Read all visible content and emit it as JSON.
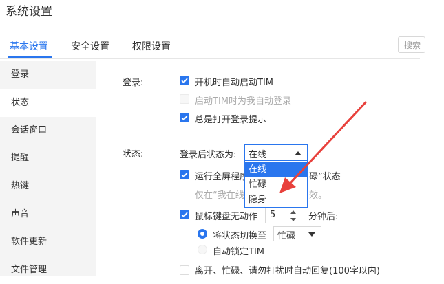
{
  "window": {
    "title": "系统设置"
  },
  "tabs": [
    {
      "label": "基本设置",
      "active": true
    },
    {
      "label": "安全设置",
      "active": false
    },
    {
      "label": "权限设置",
      "active": false
    }
  ],
  "search": {
    "placeholder": "搜索"
  },
  "sidebar": {
    "items": [
      {
        "label": "登录",
        "active": false
      },
      {
        "label": "状态",
        "active": true
      },
      {
        "label": "会话窗口",
        "active": false
      },
      {
        "label": "提醒",
        "active": false
      },
      {
        "label": "热键",
        "active": false
      },
      {
        "label": "声音",
        "active": false
      },
      {
        "label": "软件更新",
        "active": false
      },
      {
        "label": "文件管理",
        "active": false
      }
    ]
  },
  "login_section": {
    "label": "登录:",
    "options": [
      {
        "label": "开机时自动启动TIM",
        "checked": true,
        "disabled": false
      },
      {
        "label": "启动TIM时为我自动登录",
        "checked": false,
        "disabled": true
      },
      {
        "label": "总是打开登录提示",
        "checked": true,
        "disabled": false
      }
    ]
  },
  "status_section": {
    "label": "状态:",
    "after_login_label": "登录后状态为:",
    "after_login_value": "在线",
    "dropdown_options": [
      "在线",
      "忙碌",
      "隐身"
    ],
    "dropdown_selected": "在线",
    "fullscreen_label_prefix": "运行全屏程序",
    "fullscreen_label_suffix": "碌”状态",
    "fullscreen_checked": true,
    "fullscreen_note_prefix": "仅在“我在线",
    "fullscreen_note_suffix": "效。",
    "idle_label": "鼠标键盘无动作",
    "idle_checked": true,
    "idle_minutes": "5",
    "idle_suffix": "分钟后:",
    "switch_status_label": "将状态切换至",
    "switch_status_value": "忙碌",
    "auto_lock_label": "自动锁定TIM",
    "auto_reply_label": "离开、忙碌、请勿打扰时自动回复(100字以内)",
    "auto_reply_checked": false
  },
  "colors": {
    "accent": "#2a76ee",
    "annotation_arrow": "#e8413c"
  }
}
